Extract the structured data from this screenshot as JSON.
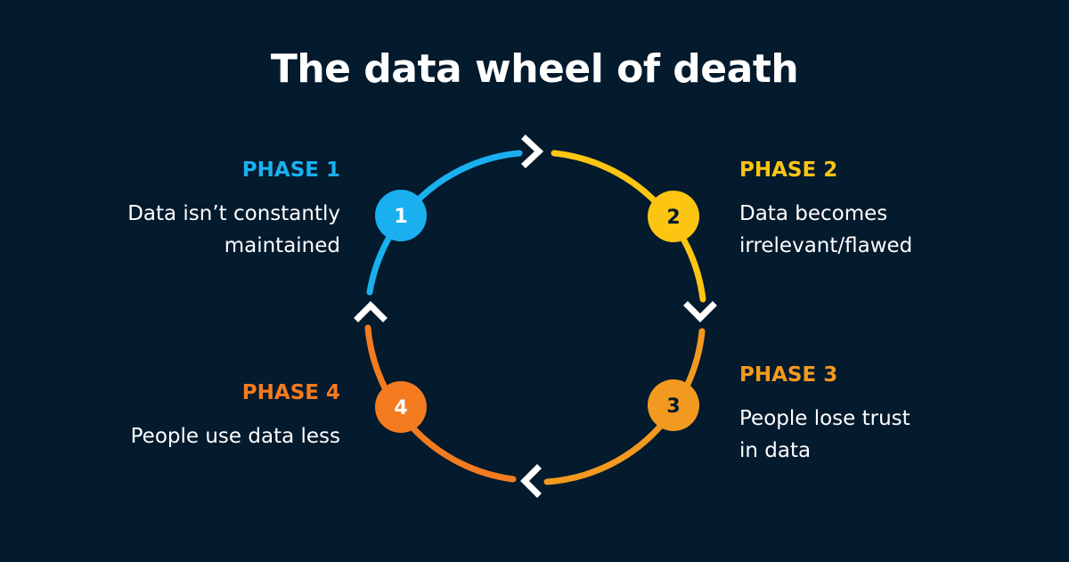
{
  "title": "The data wheel of death",
  "phases": [
    {
      "label": "PHASE 1",
      "desc_line1": "Data isn’t constantly",
      "desc_line2": "maintained",
      "number": "1",
      "color": "#1ab0ef"
    },
    {
      "label": "PHASE 2",
      "desc_line1": "Data becomes",
      "desc_line2": "irrelevant/flawed",
      "number": "2",
      "color": "#fbc512"
    },
    {
      "label": "PHASE 3",
      "desc_line1": "People lose trust",
      "desc_line2": "in data",
      "number": "3",
      "color": "#f29a1f"
    },
    {
      "label": "PHASE 4",
      "desc_line1": "People use data less",
      "desc_line2": "",
      "number": "4",
      "color": "#f47b20"
    }
  ],
  "colors": {
    "background": "#041a2d",
    "text": "#ffffff",
    "chevron": "#ffffff"
  },
  "icons": [
    "chevron-right-icon",
    "chevron-down-icon",
    "chevron-left-icon",
    "chevron-up-icon"
  ]
}
